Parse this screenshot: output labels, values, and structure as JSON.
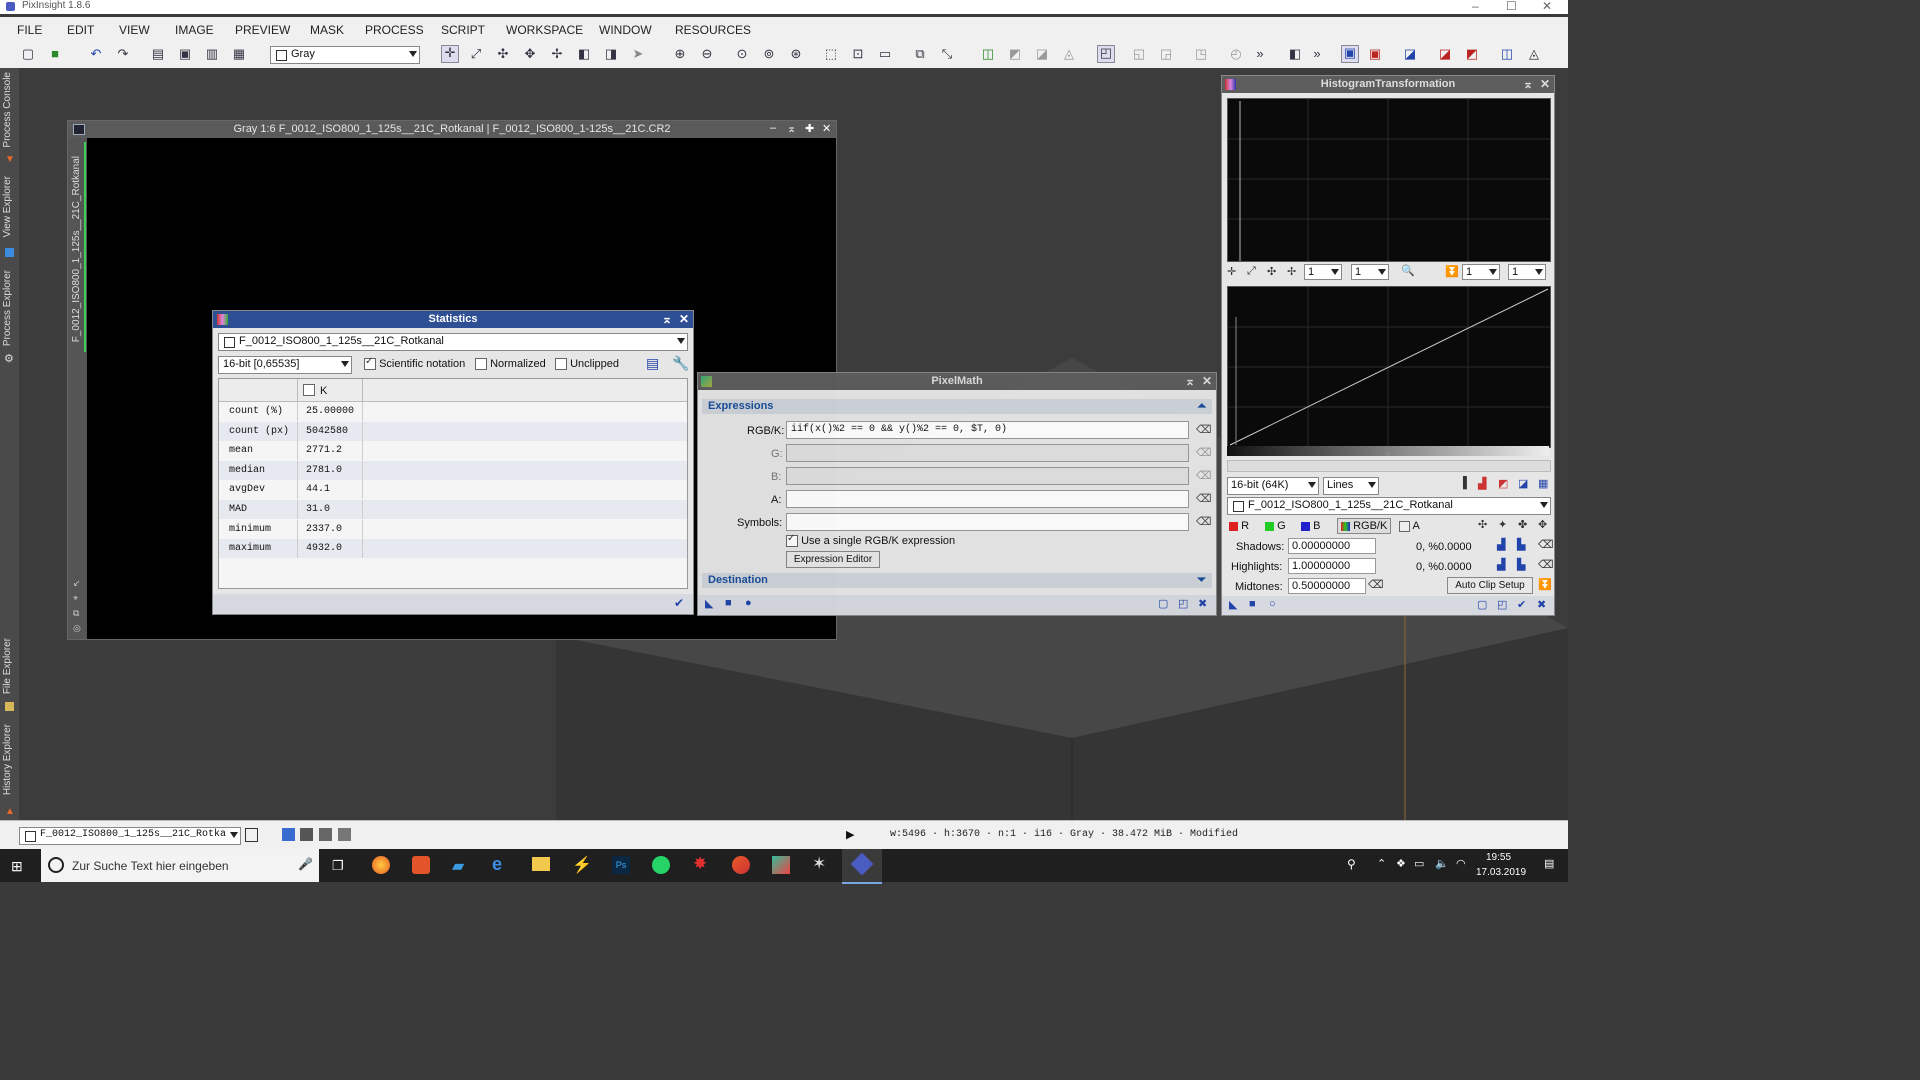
{
  "window": {
    "title": "PixInsight 1.8.6",
    "minimize": "–",
    "maximize": "☐",
    "close": "✕"
  },
  "menu": [
    "FILE",
    "EDIT",
    "VIEW",
    "IMAGE",
    "PREVIEW",
    "MASK",
    "PROCESS",
    "SCRIPT",
    "WORKSPACE",
    "WINDOW",
    "RESOURCES"
  ],
  "toolbar": {
    "channel_select": "Gray"
  },
  "sidebar": {
    "process_console": "Process Console",
    "view_explorer": "View Explorer",
    "process_explorer": "Process Explorer",
    "file_explorer": "File Explorer",
    "history_explorer": "History Explorer"
  },
  "image_window": {
    "title": "Gray 1:6 F_0012_ISO800_1_125s__21C_Rotkanal | F_0012_ISO800_1-125s__21C.CR2",
    "side_label": "F_0012_ISO800_1_125s__21C_Rotkanal"
  },
  "statistics": {
    "title": "Statistics",
    "view": "F_0012_ISO800_1_125s__21C_Rotkanal",
    "range": "16-bit [0,65535]",
    "scientific": "Scientific notation",
    "normalized": "Normalized",
    "unclipped": "Unclipped",
    "column": "K",
    "rows": [
      {
        "label": "count (%)",
        "value": "25.00000"
      },
      {
        "label": "count (px)",
        "value": "5042580"
      },
      {
        "label": "mean",
        "value": "2771.2"
      },
      {
        "label": "median",
        "value": "2781.0"
      },
      {
        "label": "avgDev",
        "value": "44.1"
      },
      {
        "label": "MAD",
        "value": "31.0"
      },
      {
        "label": "minimum",
        "value": "2337.0"
      },
      {
        "label": "maximum",
        "value": "4932.0"
      }
    ]
  },
  "pixelmath": {
    "title": "PixelMath",
    "expressions": "Expressions",
    "rgbk_label": "RGB/K:",
    "rgbk_value": "iif(x()%2 == 0 && y()%2 == 0, $T, 0)",
    "g_label": "G:",
    "b_label": "B:",
    "a_label": "A:",
    "symbols_label": "Symbols:",
    "single_expr": "Use a single RGB/K expression",
    "expr_editor": "Expression Editor",
    "destination": "Destination"
  },
  "histogram": {
    "title": "HistogramTransformation",
    "zoom_h": "1",
    "zoom_v": "1",
    "zoom_h2": "1",
    "zoom_v2": "1",
    "resolution": "16-bit (64K)",
    "graph_style": "Lines",
    "view": "F_0012_ISO800_1_125s__21C_Rotkanal",
    "ch_r": "R",
    "ch_g": "G",
    "ch_b": "B",
    "ch_rgbk": "RGB/K",
    "ch_a": "A",
    "shadows_label": "Shadows:",
    "shadows": "0.00000000",
    "shadows_clip": "0, %0.0000",
    "highlights_label": "Highlights:",
    "highlights": "1.00000000",
    "highlights_clip": "0, %0.0000",
    "midtones_label": "Midtones:",
    "midtones": "0.50000000",
    "auto_clip": "Auto Clip Setup"
  },
  "statusbar": {
    "view": "F_0012_ISO800_1_125s__21C_Rotka",
    "info": "w:5496 · h:3670 · n:1 · i16 · Gray · 38.472 MiB · Modified"
  },
  "taskbar": {
    "search_placeholder": "Zur Suche Text hier eingeben",
    "time": "19:55",
    "date": "17.03.2019"
  },
  "colors": {
    "panel_title": "#2f4f95",
    "accent_blue": "#1a4f9a"
  }
}
